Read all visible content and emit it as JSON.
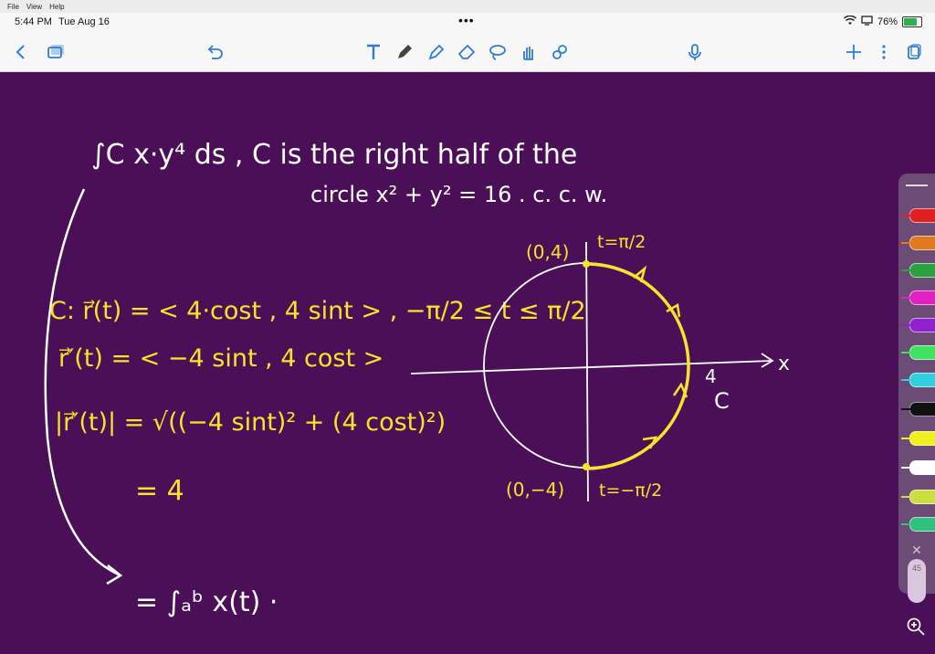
{
  "menubar": {
    "items": [
      "File",
      "View",
      "Help"
    ]
  },
  "status": {
    "time": "5:44 PM",
    "date": "Tue Aug 16",
    "dots": "•••",
    "battery": "76%"
  },
  "toolbar": {
    "icons": [
      "back-chevron-icon",
      "pages-icon",
      "undo-icon",
      "text-tool-icon",
      "pen-icon",
      "highlighter-icon",
      "eraser-icon",
      "lasso-icon",
      "shapes-hand-icon",
      "link-icon",
      "microphone-icon",
      "add-icon",
      "more-icon",
      "export-icon"
    ]
  },
  "note": {
    "line1": "∫C x·y⁴ ds ,  C  is the right half of the",
    "line2": "circle  x² + y² = 16  .   c. c. w.",
    "param": "C: r⃗(t) = < 4·cost , 4 sint > ,  −π/2 ≤ t ≤ π/2",
    "deriv": "r⃗′(t) = < −4 sint , 4 cost >",
    "mag": "|r⃗′(t)| = √((−4 sint)² + (4 cost)²)",
    "eq4": "= 4",
    "integral": "= ∫ₐᵇ x(t) ·",
    "label_top": "(0,4)",
    "label_bottom": "(0,−4)",
    "t_top": "t=π/2",
    "t_bottom": "t=−π/2",
    "x_axis": "x",
    "four": "4",
    "curve_c": "C"
  },
  "rail": {
    "page_num": "45",
    "pens": [
      "#e02020",
      "#e07a20",
      "#2aa040",
      "#e020c0",
      "#9020d0",
      "#40e060",
      "#30d0e0",
      "#111111",
      "#f0f020",
      "#ffffff",
      "#c8e040",
      "#30c080"
    ]
  },
  "colors": {
    "background": "#4a0f57",
    "ink_white": "#ffffff",
    "ink_yellow": "#f7e32a"
  }
}
